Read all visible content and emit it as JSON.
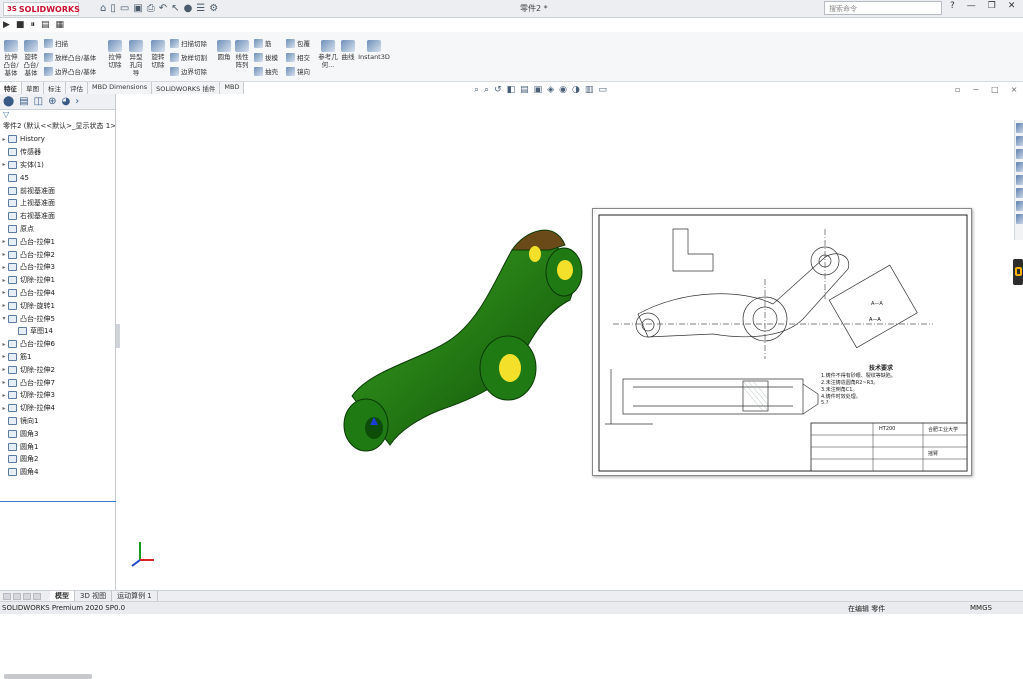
{
  "app": {
    "logo": "SOLIDWORKS",
    "window_title": "零件2 *",
    "search_placeholder": "搜索命令",
    "window_buttons": {
      "help": "?",
      "minimize": "—",
      "restore": "❐",
      "close": "✕"
    }
  },
  "command_manager": {
    "extrude_boss": "拉伸凸台/基体",
    "revolve_boss": "旋转凸台/基体",
    "sweep": "扫描",
    "loft_boss": "放样凸台/基体",
    "boundary_boss": "边界凸台/基体",
    "extrude_cut": "拉伸切除",
    "hole_wizard": "异型孔向导",
    "revolve_cut": "旋转切除",
    "swept_cut": "扫描切除",
    "lofted_cut": "放样切割",
    "boundary_cut": "边界切除",
    "fillet": "圆角",
    "linear_pattern": "线性阵列",
    "rib": "筋",
    "draft": "拔模",
    "shell": "抽壳",
    "wrap": "包覆",
    "intersect": "相交",
    "mirror": "镜向",
    "reference_geometry": "参考几何...",
    "curves": "曲线",
    "instant3d": "Instant3D"
  },
  "tabs": [
    "特征",
    "草图",
    "标注",
    "评估",
    "MBD Dimensions",
    "SOLIDWORKS 插件",
    "MBD"
  ],
  "active_tab": "特征",
  "tree": {
    "root": "零件2 (默认<<默认>_显示状态 1>)",
    "items": [
      {
        "label": "History",
        "arrow": "▸"
      },
      {
        "label": "传感器",
        "arrow": ""
      },
      {
        "label": "实体(1)",
        "arrow": "▸"
      },
      {
        "label": "45",
        "arrow": ""
      },
      {
        "label": "前视基准面",
        "arrow": ""
      },
      {
        "label": "上视基准面",
        "arrow": ""
      },
      {
        "label": "右视基准面",
        "arrow": ""
      },
      {
        "label": "原点",
        "arrow": ""
      },
      {
        "label": "凸台-拉伸1",
        "arrow": "▸"
      },
      {
        "label": "凸台-拉伸2",
        "arrow": "▸"
      },
      {
        "label": "凸台-拉伸3",
        "arrow": "▸"
      },
      {
        "label": "切除-拉伸1",
        "arrow": "▸"
      },
      {
        "label": "凸台-拉伸4",
        "arrow": "▸"
      },
      {
        "label": "切除-旋转1",
        "arrow": "▸"
      },
      {
        "label": "凸台-拉伸5",
        "arrow": "▾"
      },
      {
        "label": "草图14",
        "arrow": ""
      },
      {
        "label": "凸台-拉伸6",
        "arrow": "▸"
      },
      {
        "label": "筋1",
        "arrow": "▸"
      },
      {
        "label": "切除-拉伸2",
        "arrow": "▸"
      },
      {
        "label": "凸台-拉伸7",
        "arrow": "▸"
      },
      {
        "label": "切除-拉伸3",
        "arrow": "▸"
      },
      {
        "label": "切除-拉伸4",
        "arrow": "▸"
      },
      {
        "label": "镜向1",
        "arrow": ""
      },
      {
        "label": "圆角3",
        "arrow": ""
      },
      {
        "label": "圆角1",
        "arrow": ""
      },
      {
        "label": "圆角2",
        "arrow": ""
      },
      {
        "label": "圆角4",
        "arrow": ""
      }
    ]
  },
  "bottom_tabs": [
    "模型",
    "3D 视图",
    "运动算例 1"
  ],
  "status": {
    "left": "SOLIDWORKS Premium 2020 SP0.0",
    "mode": "在编辑 零件",
    "units": "MMGS"
  },
  "drawing": {
    "section_label": "A—A",
    "tech_req_title": "技术要求",
    "tech_req_lines": [
      "1.铸件不得有砂眼、裂纹等缺陷。",
      "2.未注铸造圆角R2~R3。",
      "3.未注倒角C1。",
      "4.铸件时效处理。",
      "5.?"
    ],
    "title_block": {
      "material": "HT200",
      "school": "合肥工业大学",
      "part_name": "摇臂"
    }
  },
  "colors": {
    "part_body": "#1f7a14",
    "part_dark": "#0e4d08",
    "hole_yellow": "#f2e02a",
    "accent_blue": "#3a7bd5"
  }
}
